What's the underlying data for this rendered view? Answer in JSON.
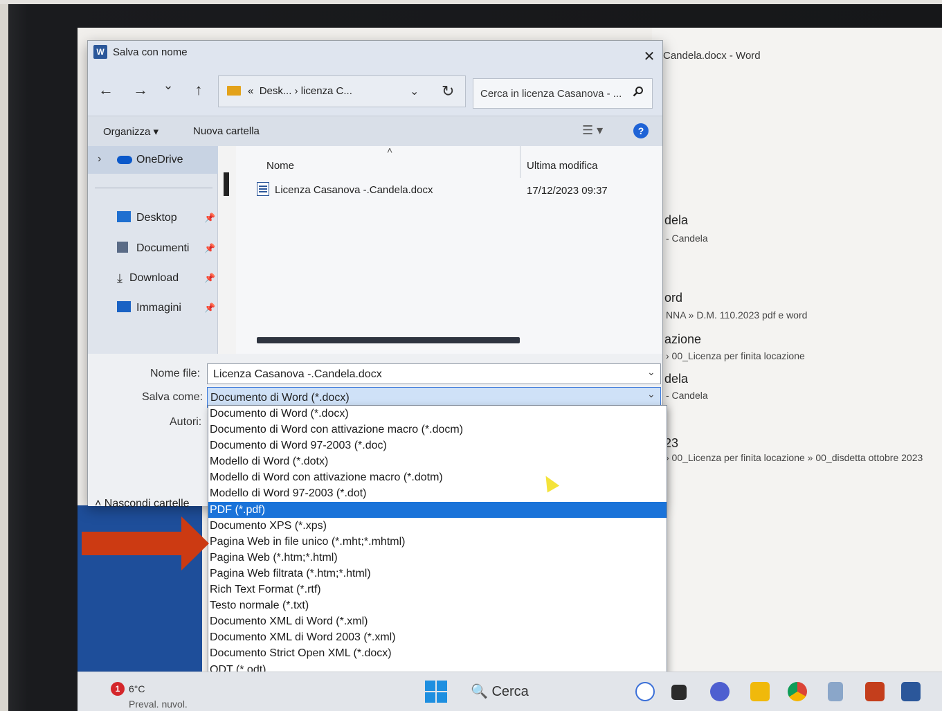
{
  "dialog": {
    "title": "Salva con nome",
    "close_glyph": "✕",
    "nav": {
      "back": "←",
      "forward": "→",
      "recent": "⌄",
      "up": "↑"
    },
    "address": {
      "prefix": "«",
      "path": "Desk...  ›  licenza C...",
      "chevron": "⌄",
      "refresh": "↻"
    },
    "search": {
      "placeholder": "Cerca in licenza Casanova - ...",
      "icon": "search-icon"
    },
    "toolbar": {
      "organize": "Organizza ▾",
      "new_folder": "Nuova cartella",
      "view_glyph": "☰ ▾",
      "help": "?"
    },
    "nav_pane": {
      "onedrive": "OneDrive",
      "expand_glyph": "›",
      "items": [
        {
          "label": "Desktop",
          "icon": "desktop-icon"
        },
        {
          "label": "Documenti",
          "icon": "documents-icon"
        },
        {
          "label": "Download",
          "icon": "download-icon"
        },
        {
          "label": "Immagini",
          "icon": "pictures-icon"
        }
      ],
      "pin_glyph": "📌"
    },
    "file_list": {
      "columns": [
        "Nome",
        "Ultima modifica"
      ],
      "sort_glyph": "˄",
      "files": [
        {
          "name": "Licenza Casanova -.Candela.docx",
          "modified": "17/12/2023 09:37"
        }
      ]
    },
    "form": {
      "filename_label": "Nome file:",
      "filename_value": "Licenza Casanova -.Candela.docx",
      "savetype_label": "Salva come:",
      "savetype_value": "Documento di Word (*.docx)",
      "authors_label": "Autori:",
      "hide_folders": "˄  Nascondi cartelle",
      "chevron": "⌄"
    }
  },
  "dropdown": {
    "selected_index": 6,
    "options": [
      "Documento di Word (*.docx)",
      "Documento di Word con attivazione macro (*.docm)",
      "Documento di Word 97-2003 (*.doc)",
      "Modello di Word (*.dotx)",
      "Modello di Word con attivazione macro (*.dotm)",
      "Modello di Word 97-2003 (*.dot)",
      "PDF (*.pdf)",
      "Documento XPS (*.xps)",
      "Pagina Web in file unico (*.mht;*.mhtml)",
      "Pagina Web (*.htm;*.html)",
      "Pagina Web filtrata (*.htm;*.html)",
      "Rich Text Format (*.rtf)",
      "Testo normale (*.txt)",
      "Documento XML di Word (*.xml)",
      "Documento XML di Word 2003 (*.xml)",
      "Documento Strict Open XML (*.docx)",
      "ODT (*.odt)"
    ]
  },
  "word_background": {
    "title": "Candela.docx - Word",
    "recent": [
      {
        "name": "dela",
        "path": "- Candela"
      },
      {
        "name": "ord",
        "path": "NNA » D.M. 110.2023 pdf e word"
      },
      {
        "name": "azione",
        "path": "› 00_Licenza per finita locazione"
      },
      {
        "name": "dela",
        "path": "- Candela"
      },
      {
        "name": "23",
        "path": "› 00_Licenza per finita locazione » 00_disdetta ottobre 2023"
      }
    ]
  },
  "taskbar": {
    "weather_badge": "1",
    "weather_temp": "6°C",
    "weather_desc": "Preval. nuvol.",
    "search_label": "🔍 Cerca",
    "apps": [
      "bing-icon",
      "task-view-icon",
      "teams-icon",
      "explorer-icon",
      "chrome-icon",
      "snipping-icon",
      "powerpoint-icon",
      "word-icon"
    ]
  },
  "colors": {
    "accent": "#1a73d9",
    "annotation_arrow": "#cc3a12",
    "word_blue": "#2b579a"
  }
}
